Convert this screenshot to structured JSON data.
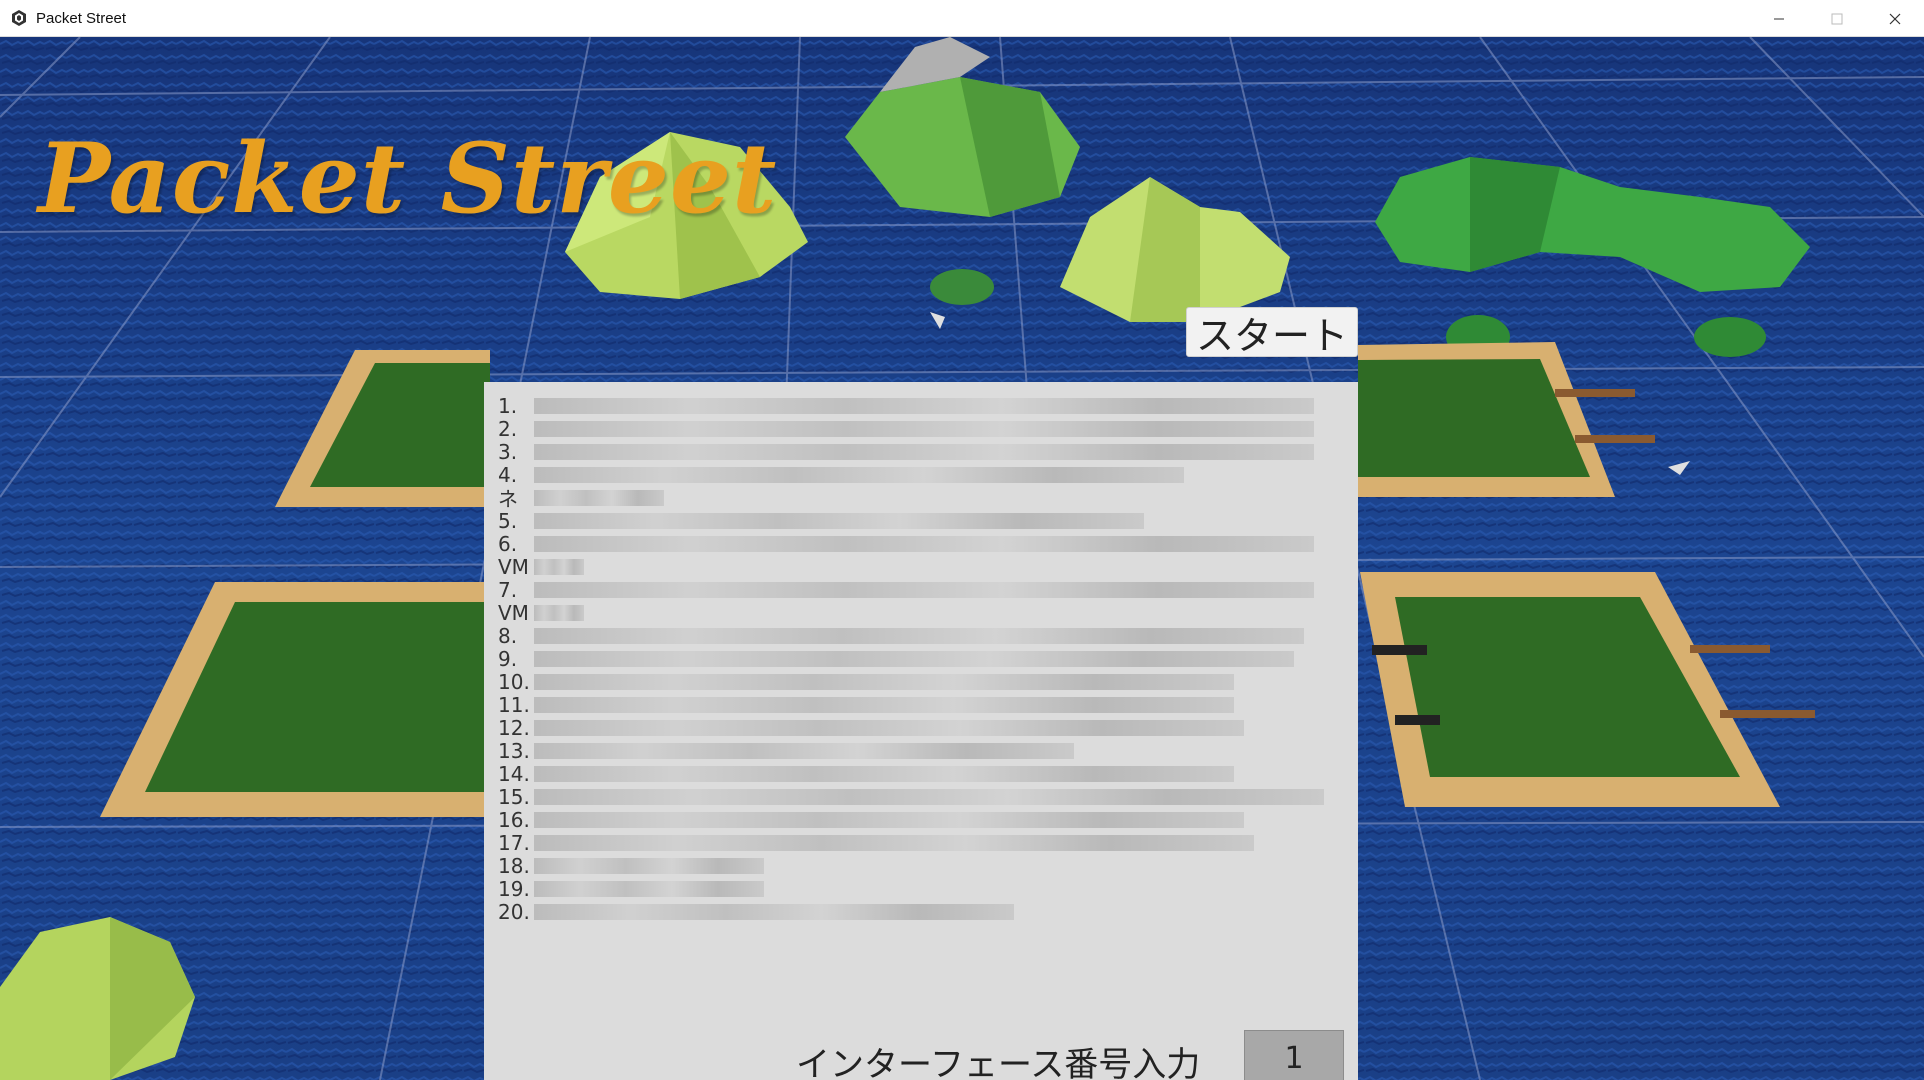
{
  "window": {
    "title": "Packet Street",
    "controls": [
      "minimize-icon",
      "maximize-icon",
      "close-icon"
    ]
  },
  "game": {
    "logo_text": "Packet Street",
    "start_button_label": "スタート",
    "interface_label": "インターフェース番号入力",
    "interface_number": "1",
    "interface_list": [
      {
        "num": "1.",
        "text": ""
      },
      {
        "num": "2.",
        "text": ""
      },
      {
        "num": "3.",
        "text": ""
      },
      {
        "num": "4.",
        "text": ""
      },
      {
        "num": "ネ",
        "text": ""
      },
      {
        "num": "5.",
        "text": ""
      },
      {
        "num": "6.",
        "text": ""
      },
      {
        "num": "VM",
        "text": ""
      },
      {
        "num": "7.",
        "text": ""
      },
      {
        "num": "VM",
        "text": ""
      },
      {
        "num": "8.",
        "text": ""
      },
      {
        "num": "9.",
        "text": ""
      },
      {
        "num": "10.",
        "text": ""
      },
      {
        "num": "11.",
        "text": ""
      },
      {
        "num": "12.",
        "text": ""
      },
      {
        "num": "13.",
        "text": ""
      },
      {
        "num": "14.",
        "text": ""
      },
      {
        "num": "15.",
        "text": ""
      },
      {
        "num": "16.",
        "text": ""
      },
      {
        "num": "17.",
        "text": ""
      },
      {
        "num": "18.",
        "text": ""
      },
      {
        "num": "19.",
        "text": ""
      },
      {
        "num": "20.",
        "text": ""
      }
    ]
  },
  "colors": {
    "ocean": "#1a3f8c",
    "logo": "#e8a020",
    "island_light": "#b8d860",
    "island_dark": "#3aa040",
    "field": "#2f6b24",
    "sand": "#d8b070"
  }
}
